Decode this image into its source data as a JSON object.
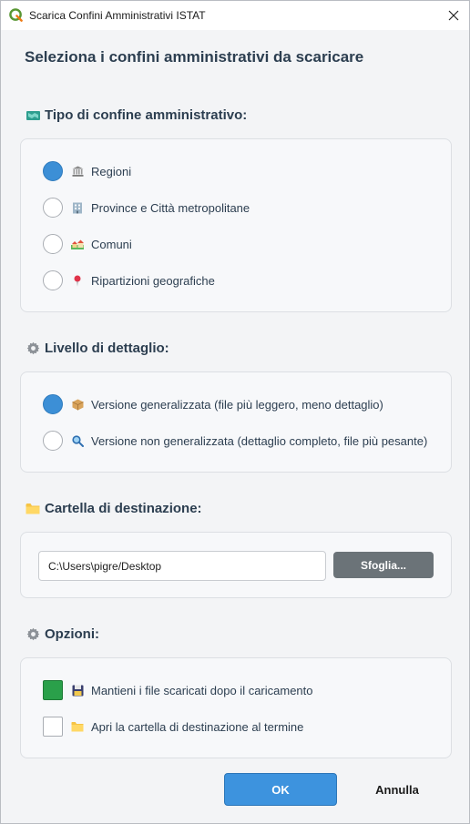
{
  "window": {
    "title": "Scarica Confini Amministrativi ISTAT"
  },
  "heading": "Seleziona i confini amministrativi da scaricare",
  "sections": {
    "tipo": {
      "title": "Tipo di confine amministrativo:",
      "icon": "map-icon",
      "options": [
        {
          "label": "Regioni",
          "icon": "classical-building-icon",
          "checked": true
        },
        {
          "label": "Province e Città metropolitane",
          "icon": "office-building-icon",
          "checked": false
        },
        {
          "label": "Comuni",
          "icon": "houses-icon",
          "checked": false
        },
        {
          "label": "Ripartizioni geografiche",
          "icon": "pushpin-icon",
          "checked": false
        }
      ]
    },
    "livello": {
      "title": "Livello di dettaglio:",
      "icon": "gear-icon",
      "options": [
        {
          "label": "Versione generalizzata (file più leggero, meno dettaglio)",
          "icon": "package-icon",
          "checked": true
        },
        {
          "label": "Versione non generalizzata (dettaglio completo, file più pesante)",
          "icon": "magnifier-icon",
          "checked": false
        }
      ]
    },
    "cartella": {
      "title": "Cartella di destinazione:",
      "icon": "folder-icon",
      "path_value": "C:\\Users\\pigre/Desktop",
      "browse_label": "Sfoglia..."
    },
    "opzioni": {
      "title": "Opzioni:",
      "icon": "gear-icon",
      "options": [
        {
          "label": "Mantieni i file scaricati dopo il caricamento",
          "icon": "floppy-disk-icon",
          "checked": true
        },
        {
          "label": "Apri la cartella di destinazione al termine",
          "icon": "folder-icon",
          "checked": false
        }
      ]
    }
  },
  "buttons": {
    "ok": "OK",
    "cancel": "Annulla"
  },
  "colors": {
    "accent": "#3d93de",
    "checkbox_checked": "#2aa04a",
    "heading": "#2c3e50"
  }
}
